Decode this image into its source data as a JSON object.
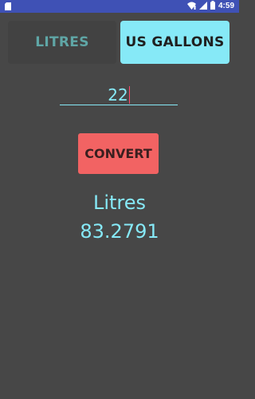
{
  "status_bar": {
    "time": "4:59",
    "left_icon": "sd-card-icon",
    "right_icons": [
      "wifi-icon",
      "signal-icon",
      "battery-icon"
    ]
  },
  "units": {
    "litres_label": "LITRES",
    "gallons_label": "US GALLONS",
    "selected": "US GALLONS"
  },
  "input": {
    "value": "22"
  },
  "convert": {
    "label": "CONVERT"
  },
  "result": {
    "unit": "Litres",
    "value": "83.2791"
  },
  "colors": {
    "background": "#474747",
    "accent": "#86e9f7",
    "convert_button": "#f26363",
    "status_bar": "#3f51b5"
  }
}
